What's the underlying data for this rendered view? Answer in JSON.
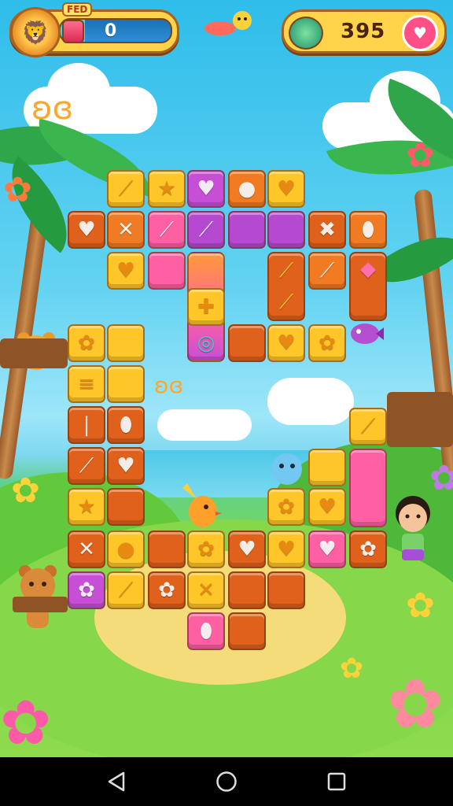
{
  "hud": {
    "badge": "FED",
    "moves_value": "0",
    "score_value": "395"
  },
  "board": {
    "tiles": [
      {
        "color": "yel",
        "icon": "⟋"
      },
      {
        "color": "yel",
        "icon": "★"
      },
      {
        "color": "mag",
        "icon": "♥"
      },
      {
        "color": "org",
        "icon": "●"
      },
      {
        "color": "yel",
        "icon": "♥"
      },
      {
        "color": "dark",
        "icon": "♥"
      },
      {
        "color": "org",
        "icon": "✕"
      },
      {
        "color": "pink",
        "icon": "⟋"
      },
      {
        "color": "pur",
        "icon": "⟋"
      },
      {
        "color": "pur",
        "icon": ""
      },
      {
        "color": "pur",
        "icon": ""
      },
      {
        "color": "dark",
        "icon": "✖"
      },
      {
        "color": "org",
        "icon": "⬮"
      },
      {
        "color": "yel",
        "icon": "♥"
      },
      {
        "color": "pink",
        "icon": ""
      },
      {
        "color": "org",
        "icon": "⟋"
      },
      {
        "color": "pur",
        "icon": "♦"
      },
      {
        "color": "dark",
        "icon": ""
      },
      {
        "color": "yel",
        "icon": "♥"
      },
      {
        "color": "yel",
        "icon": "✿"
      },
      {
        "color": "yel",
        "icon": "✿"
      },
      {
        "color": "yel",
        "icon": ""
      },
      {
        "color": "yel",
        "icon": "≡"
      },
      {
        "color": "yel",
        "icon": ""
      },
      {
        "color": "dark",
        "icon": "|"
      },
      {
        "color": "dark",
        "icon": "⬮"
      },
      {
        "color": "dark",
        "icon": "⟋"
      },
      {
        "color": "dark",
        "icon": "♥"
      },
      {
        "color": "yel",
        "icon": "★"
      },
      {
        "color": "dark",
        "icon": ""
      },
      {
        "color": "dark",
        "icon": "✕"
      },
      {
        "color": "yel",
        "icon": "●"
      },
      {
        "color": "dark",
        "icon": ""
      },
      {
        "color": "yel",
        "icon": "✿"
      },
      {
        "color": "dark",
        "icon": "♥"
      },
      {
        "color": "yel",
        "icon": "♥"
      },
      {
        "color": "pink",
        "icon": "♥"
      },
      {
        "color": "dark",
        "icon": "✿"
      },
      {
        "color": "mag",
        "icon": "✿"
      },
      {
        "color": "yel",
        "icon": "⟋"
      },
      {
        "color": "dark",
        "icon": "✿"
      },
      {
        "color": "yel",
        "icon": "✕"
      },
      {
        "color": "dark",
        "icon": ""
      },
      {
        "color": "dark",
        "icon": ""
      },
      {
        "color": "pink",
        "icon": "⬮"
      },
      {
        "color": "dark",
        "icon": ""
      },
      {
        "color": "yel",
        "icon": ""
      },
      {
        "color": "yel",
        "icon": "♥"
      },
      {
        "color": "yel",
        "icon": "✿"
      },
      {
        "color": "yel",
        "icon": "⬮"
      },
      {
        "color": "yel",
        "icon": "⟋"
      }
    ]
  },
  "colors": {
    "yel": "#ffc62a",
    "org": "#f07b22",
    "dark": "#e0611c",
    "pink": "#ff5fa3",
    "mag": "#c74fd6",
    "pur": "#b54ad1"
  },
  "navbar": {
    "back_icon": "back-triangle-icon",
    "home_icon": "home-circle-icon",
    "recents_icon": "recents-square-icon"
  }
}
